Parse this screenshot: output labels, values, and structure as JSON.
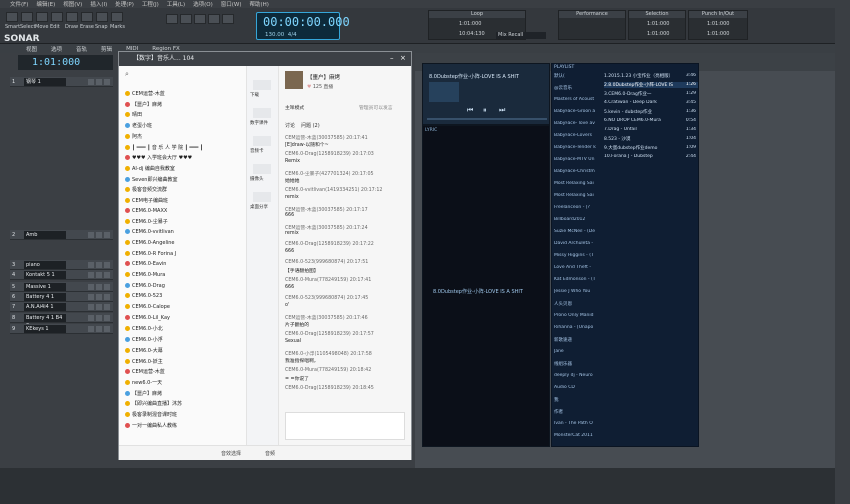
{
  "menu": [
    "文件(F)",
    "编辑(E)",
    "视图(V)",
    "插入(I)",
    "处理(P)",
    "工程(J)",
    "工具(L)",
    "选项(O)",
    "窗口(W)",
    "帮助(H)"
  ],
  "app": {
    "logo": "SONAR"
  },
  "tools": [
    "Smart",
    "Select",
    "Move",
    "Edit",
    "Draw",
    "Erase",
    "Snap",
    "Marks"
  ],
  "transport": {
    "time": "00:00:00.000",
    "tempo": "130.00",
    "meter": "4/4"
  },
  "panels": {
    "loop": "Loop",
    "performance": "Performance",
    "selection": "Selection",
    "punch": "Punch In/Out",
    "loop_a": "1:01:000",
    "loop_b": "10:04:130",
    "mix": "Mix Recall",
    "sel_a": "1:01:000",
    "sel_b": "1:01:000",
    "punch_a": "1:01:000",
    "punch_b": "1:01:000"
  },
  "secondbar": [
    "视图",
    "选项",
    "音轨",
    "剪辑",
    "MIDI",
    "Region FX"
  ],
  "bigtime": "1:01:000",
  "tracks": [
    {
      "num": "1",
      "name": "钢琴 1"
    },
    {
      "num": "2",
      "name": "Amb"
    },
    {
      "num": "3",
      "name": "piano"
    },
    {
      "num": "4",
      "name": "Kontakt 5 1"
    },
    {
      "num": "5",
      "name": "Massive 1"
    },
    {
      "num": "6",
      "name": "Battery 4 1"
    },
    {
      "num": "7",
      "name": "A.N.Ai4i4 1"
    },
    {
      "num": "8",
      "name": "Battery 4 1 B4 2"
    },
    {
      "num": "9",
      "name": "KEkeys 1"
    }
  ],
  "chat": {
    "title": "【数字】音乐人... 104",
    "toolbar": [
      "下载",
      "数字课件",
      "音频卡",
      "摄像头",
      "桌面分享"
    ],
    "header_name": "【噩户】麻烤",
    "header_count": "125",
    "header_sub": "直播",
    "section_left": "主咩模式",
    "section_right": "管理员可以发言",
    "tabs_label": "讨论",
    "tabs_extra": "问题 (2)",
    "left_items": [
      "CEM运营-木蓝",
      "【噩户】麻烤",
      "晴田",
      "老蛋小班",
      "阿杰",
      "┃ ═══ ┃ 音 乐 人 学 院 ┃ ═══ ┃",
      "♥♥♥ 入学班会大厅 ♥♥♥",
      "AI-dj 编曲自我教室",
      "Seven即兴编曲教室",
      "极客音频交流群",
      "CEM电子编曲班",
      "CEM6.0-MAXX",
      "CEM6.0-尘暴子",
      "CEM6.0-vvitlivan",
      "CEM6.0-Angeline",
      "CEM6.0-R Forina J",
      "CEM6.0-Eavin",
      "CEM6.0-Mura",
      "CEM6.0-Drag",
      "CEM6.0-523",
      "CEM6.0-Calope",
      "CEM6.0-Lil_Kay",
      "CEM6.0-小北",
      "CEM6.0-小浮",
      "CEM6.0-大幕",
      "CEM6.0-妖主",
      "CEM运营-木蓝",
      "new6.0-一天",
      "【噩户】麻烤",
      "【即兴编曲直播】沐苏",
      "极客录制混音课时班",
      "一对一编曲私人教练"
    ],
    "messages": [
      {
        "who": "CEM运营-木蓝(30037585) 20:17:41",
        "text": "[E]draw-以随和个~"
      },
      {
        "who": "CEM6.0-Drag(1258918239) 20:17:03",
        "text": "Remix"
      },
      {
        "who": "CEM6.0-尘暴子(427701324) 20:17:05",
        "text": "她她她"
      },
      {
        "who": "CEM6.0-vvitlivan(1419334251) 20:17:12",
        "text": "remix"
      },
      {
        "who": "CEM运营-木蓝(30037585) 20:17:17",
        "text": "666"
      },
      {
        "who": "CEM运营-木蓝(30037585) 20:17:24",
        "text": "remix"
      },
      {
        "who": "CEM6.0-Drag(1258918239) 20:17:22",
        "text": "666"
      },
      {
        "who": "CEM6.0-523(999680874) 20:17:51",
        "text": "【手语翻拍图】"
      },
      {
        "who": "CEM6.0-Mura(778249159) 20:17:41",
        "text": "666"
      },
      {
        "who": "CEM6.0-523(999680874) 20:17:45",
        "text": "o'"
      },
      {
        "who": "CEM运营-木蓝(30037585) 20:17:46",
        "text": "片子翻拍的"
      },
      {
        "who": "CEM6.0-Drag(1258918239) 20:17:57",
        "text": "Sexual"
      },
      {
        "who": "CEM6.0-小浮(1105498048) 20:17:58",
        "text": "我准指探唱啊，"
      },
      {
        "who": "CEM6.0-Mura(778249159) 20:18:42",
        "text": "= =你说了"
      },
      {
        "who": "CEM6.0-Drag(1258918239) 20:18:45",
        "text": ""
      }
    ],
    "bottom_a": "音效选择",
    "bottom_b": "音频"
  },
  "player": {
    "title": "8.0Dubstep作业-小阵-LOVE IS A SHIT",
    "viz_text": "8.0Dubstep作业-小阵-LOVE IS A SHIT",
    "lyric_label": "LYRIC"
  },
  "playlist": {
    "header": "PLAYLIST",
    "left": [
      "默认(",
      "@云音乐",
      "Masters of Acoust",
      "BabyFace-Groon a",
      "BabyFace- love av",
      "BabyFace-Lovers",
      "BabyFace-Tender k",
      "BabyFace-MTV Un",
      "BabyFace-Christm",
      "Most Relaxing Sai",
      "Most Relaxing Sai",
      "Freelanceon - [?",
      "Billboard2012",
      "Suzie McNeil - (De",
      "David Archuleta -",
      "Missy Higgins - (T",
      "Love And Theft -",
      "Kat Edmonson - (T",
      "Jessie J Who You",
      "人头贝恩",
      "Prono Only Manid",
      "Rihanna - [Unapo",
      "新歌速递",
      "Jane",
      "线组乐器",
      "deeply dj - Neuro",
      "Audio CD",
      "我",
      "作者",
      "Ivan - The Path O",
      "MonsterCat 2011"
    ],
    "right": [
      {
        "t": "1.2015.1.23 小宝作业（亮相版）",
        "d": "3:46"
      },
      {
        "t": "2.8.0Dubstep作业-小阵-LOVE IS",
        "d": "1:26"
      },
      {
        "t": "3.CEM6.0-Drag作业一",
        "d": "1:29"
      },
      {
        "t": "4.Cratiwan - Deep Dark",
        "d": "3:45"
      },
      {
        "t": "5.kevin - dubstep作业",
        "d": "1:36"
      },
      {
        "t": "6.NO DROP CEM6.0-Mura",
        "d": "0:54"
      },
      {
        "t": "7.Drag - Unfail",
        "d": "1:34"
      },
      {
        "t": "8.523 - 沙漠",
        "d": "1:04"
      },
      {
        "t": "9.大蛋dubstep作业demo",
        "d": "1:09"
      },
      {
        "t": "10.Forana J - Dubstep",
        "d": "2:44"
      }
    ]
  }
}
